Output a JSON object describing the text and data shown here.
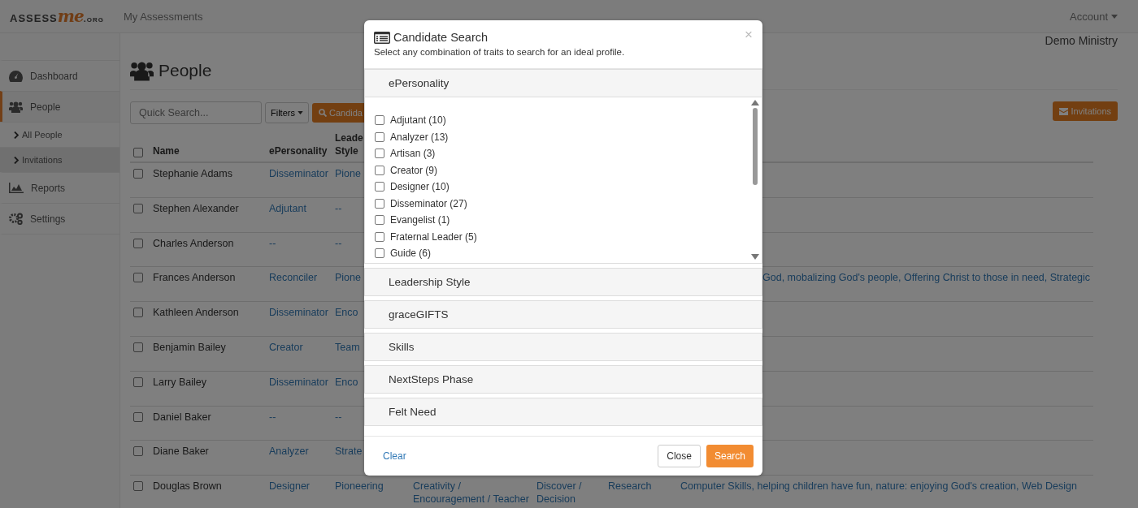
{
  "navbar": {
    "logo": {
      "prefix": "ASSESS",
      "accent": "me",
      "suffix": ".org"
    },
    "links": [
      {
        "label": "My Assessments"
      }
    ],
    "account": "Account"
  },
  "sidebar": {
    "items": [
      {
        "label": "Dashboard",
        "selected": false
      },
      {
        "label": "People",
        "selected": true,
        "children": [
          {
            "label": "All People",
            "selected": false
          },
          {
            "label": "Invitations",
            "selected": true
          }
        ]
      },
      {
        "label": "Reports",
        "selected": false
      },
      {
        "label": "Settings",
        "selected": false
      }
    ]
  },
  "organization": "Demo Ministry",
  "page_title": "People",
  "toolbar": {
    "search": {
      "placeholder": "Quick Search..."
    },
    "filters": "Filters",
    "candidate": "Candida",
    "invitations": "Invitations"
  },
  "table": {
    "select_all": {
      "checked": false
    },
    "columns": [
      "Name",
      "ePersonality",
      "Leade\nStyle"
    ],
    "rows": [
      {
        "checked": false,
        "cells": [
          {
            "text": "Stephanie Adams"
          },
          {
            "text": "Disseminator"
          },
          {
            "text": "Pione"
          }
        ]
      },
      {
        "checked": false,
        "cells": [
          {
            "text": "Stephen Alexander"
          },
          {
            "text": "Adjutant"
          },
          {
            "text": "--"
          }
        ]
      },
      {
        "checked": false,
        "cells": [
          {
            "text": "Charles Anderson"
          },
          {
            "text": "--"
          },
          {
            "text": "--"
          }
        ]
      },
      {
        "checked": false,
        "cells": [
          {
            "text": "Frances Anderson"
          },
          {
            "text": "Reconciler"
          },
          {
            "text": "Pione"
          },
          {},
          {},
          {},
          {
            "text": "God, mobalizing God's people, Offering Christ to those in need, Strategic",
            "covered": true
          }
        ]
      },
      {
        "checked": false,
        "cells": [
          {
            "text": "Kathleen Anderson"
          },
          {
            "text": "Disseminator"
          },
          {
            "text": "Enco"
          }
        ]
      },
      {
        "checked": false,
        "cells": [
          {
            "text": "Benjamin Bailey"
          },
          {
            "text": "Creator"
          },
          {
            "text": "Team"
          }
        ]
      },
      {
        "checked": false,
        "cells": [
          {
            "text": "Larry Bailey"
          },
          {
            "text": "Disseminator"
          },
          {
            "text": "Enco"
          }
        ]
      },
      {
        "checked": false,
        "cells": [
          {
            "text": "Daniel Baker"
          },
          {
            "text": "--"
          },
          {
            "text": "--"
          }
        ]
      },
      {
        "checked": false,
        "cells": [
          {
            "text": "Diane Baker"
          },
          {
            "text": "Analyzer"
          },
          {
            "text": "Strate"
          }
        ]
      },
      {
        "checked": false,
        "cells": [
          {
            "text": "Douglas Brown"
          },
          {
            "text": "Designer"
          },
          {
            "text": "Pioneering"
          },
          {
            "text": "Creativity / Encouragement / Teacher"
          },
          {
            "text": "Discover / Decision"
          },
          {
            "text": "Research"
          },
          {
            "text": "Computer Skills, helping children have fun, nature: enjoying God's creation, Web Design"
          }
        ]
      }
    ]
  },
  "modal": {
    "title": "Candidate Search",
    "subtitle": "Select any combination of traits to search for an ideal profile.",
    "close": "×",
    "panels": [
      {
        "title": "ePersonality",
        "expanded": true,
        "options": [
          {
            "label": "Adjutant (10)",
            "checked": false
          },
          {
            "label": "Analyzer (13)",
            "checked": false
          },
          {
            "label": "Artisan (3)",
            "checked": false
          },
          {
            "label": "Creator (9)",
            "checked": false
          },
          {
            "label": "Designer (10)",
            "checked": false
          },
          {
            "label": "Disseminator (27)",
            "checked": false
          },
          {
            "label": "Evangelist (1)",
            "checked": false
          },
          {
            "label": "Fraternal Leader (5)",
            "checked": false
          },
          {
            "label": "Guide (6)",
            "checked": false
          }
        ]
      },
      {
        "title": "Leadership Style",
        "expanded": false
      },
      {
        "title": "graceGIFTS",
        "expanded": false
      },
      {
        "title": "Skills",
        "expanded": false
      },
      {
        "title": "NextSteps Phase",
        "expanded": false
      },
      {
        "title": "Felt Need",
        "expanded": false
      }
    ],
    "footer": {
      "clear": "Clear",
      "close": "Close",
      "search": "Search"
    }
  }
}
